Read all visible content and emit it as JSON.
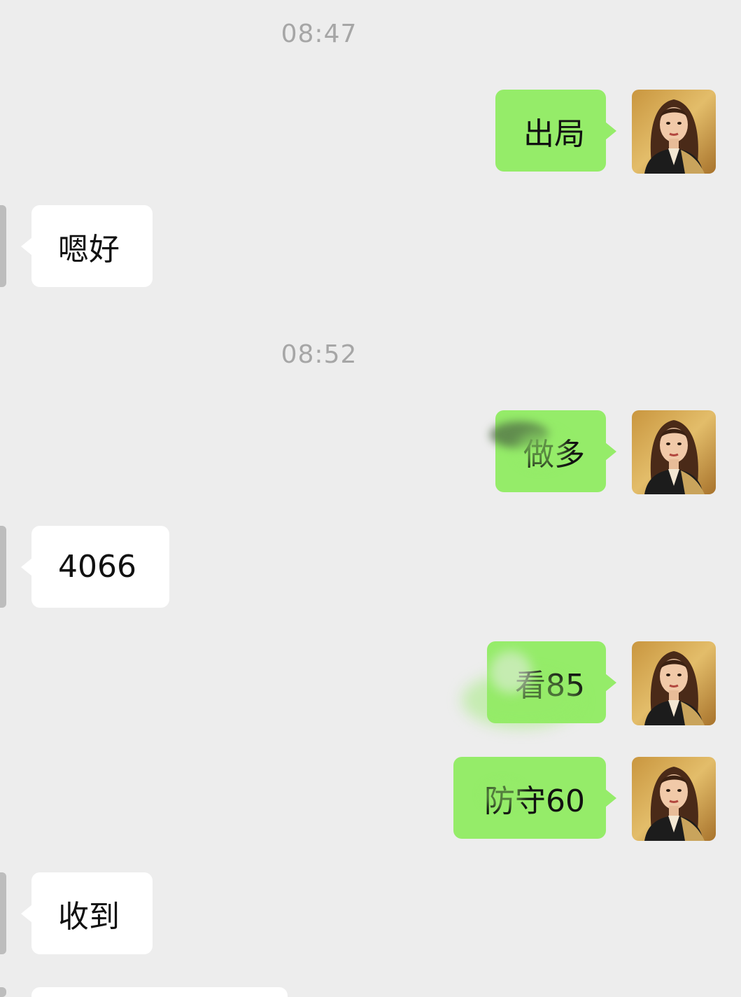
{
  "timestamps": [
    "08:47",
    "08:52"
  ],
  "messages": [
    {
      "side": "out",
      "text": "出局"
    },
    {
      "side": "in",
      "text": "嗯好"
    },
    {
      "side": "out",
      "text": "做多"
    },
    {
      "side": "in",
      "text": "4066"
    },
    {
      "side": "out",
      "text": "看85"
    },
    {
      "side": "out",
      "text": "防守60"
    },
    {
      "side": "in",
      "text": "收到"
    }
  ],
  "colors": {
    "background": "#ededed",
    "outgoing_bubble": "#95ec69",
    "incoming_bubble": "#ffffff",
    "timestamp_text": "#a6a6a6"
  },
  "icons": {
    "avatar": "woman-portrait-avatar"
  }
}
